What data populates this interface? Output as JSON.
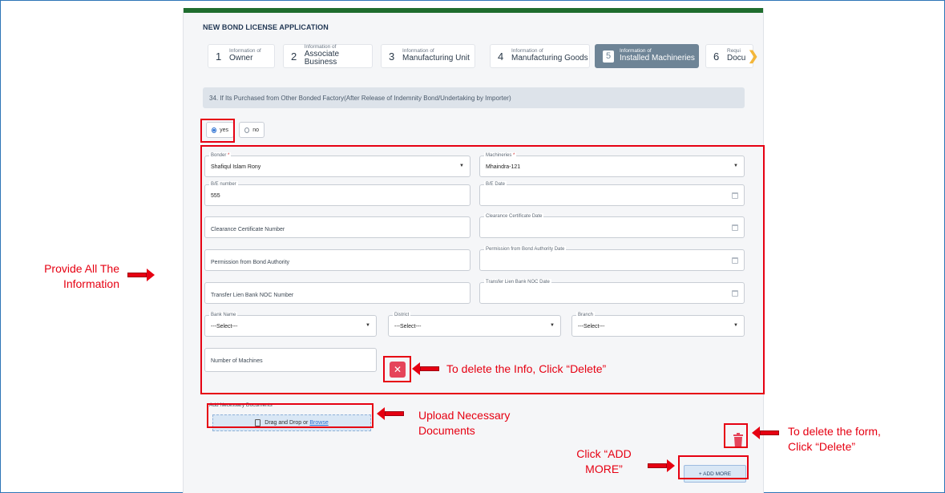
{
  "app": {
    "title": "NEW BOND LICENSE APPLICATION"
  },
  "steps": [
    {
      "num": "1",
      "small": "Information of",
      "big": "Owner"
    },
    {
      "num": "2",
      "small": "Information of",
      "big": "Associate Business"
    },
    {
      "num": "3",
      "small": "Information of",
      "big": "Manufacturing Unit"
    },
    {
      "num": "4",
      "small": "Information of",
      "big": "Manufacturing Goods"
    },
    {
      "num": "5",
      "small": "Information of",
      "big": "Installed Machineries"
    },
    {
      "num": "6",
      "small": "Requi",
      "big": "Docu"
    }
  ],
  "question": "34. If Its Purchased from Other Bonded Factory(After Release of Indemnity Bond/Undertaking by Importer)",
  "radio": {
    "yes": "yes",
    "no": "no"
  },
  "form": {
    "bonder": {
      "label": "Bonder",
      "required": "*",
      "value": "Shafiqul Islam Rony"
    },
    "machineries": {
      "label": "Machineries",
      "required": "*",
      "value": "Mhaindra-121"
    },
    "be_number": {
      "label": "B/E number",
      "value": "555"
    },
    "be_date": {
      "label": "B/E Date"
    },
    "clearance_number": {
      "placeholder": "Clearance Certificate Number"
    },
    "clearance_date": {
      "label": "Clearance Certificate Date"
    },
    "permission": {
      "placeholder": "Permission from Bond Authority"
    },
    "permission_date": {
      "label": "Permission from Bond Authority Date"
    },
    "noc_number": {
      "placeholder": "Transfer Lien Bank NOC Number"
    },
    "noc_date": {
      "label": "Transfer Lien Bank NOC Date"
    },
    "bank": {
      "label": "Bank Name",
      "value": "---Select---"
    },
    "district": {
      "label": "District",
      "value": "---Select---"
    },
    "branch": {
      "label": "Branch",
      "value": "---Select---"
    },
    "machines": {
      "placeholder": "Number of Machines"
    }
  },
  "documents": {
    "label": "Add Necessary Documents",
    "drag_text": "Drag and Drop or",
    "browse": "Browse"
  },
  "add_more": "+ ADD MORE",
  "annotations": {
    "provide_1": "Provide All The",
    "provide_2": "Information",
    "delete_info": "To delete the Info, Click “Delete”",
    "upload_1": "Upload Necessary",
    "upload_2": "Documents",
    "delete_form_1": "To delete the form,",
    "delete_form_2": "Click “Delete”",
    "addmore_1": "Click “ADD",
    "addmore_2": "MORE”"
  },
  "colors": {
    "annotation_red": "#e60012",
    "header_green": "#1f6d2e",
    "active_step": "#6e8496",
    "delete_red": "#e5445a"
  },
  "icons": {
    "delete": "close-icon",
    "trash": "trash-icon",
    "file": "file-icon",
    "calendar": "calendar-icon",
    "dropdown": "chevron-down-icon"
  }
}
